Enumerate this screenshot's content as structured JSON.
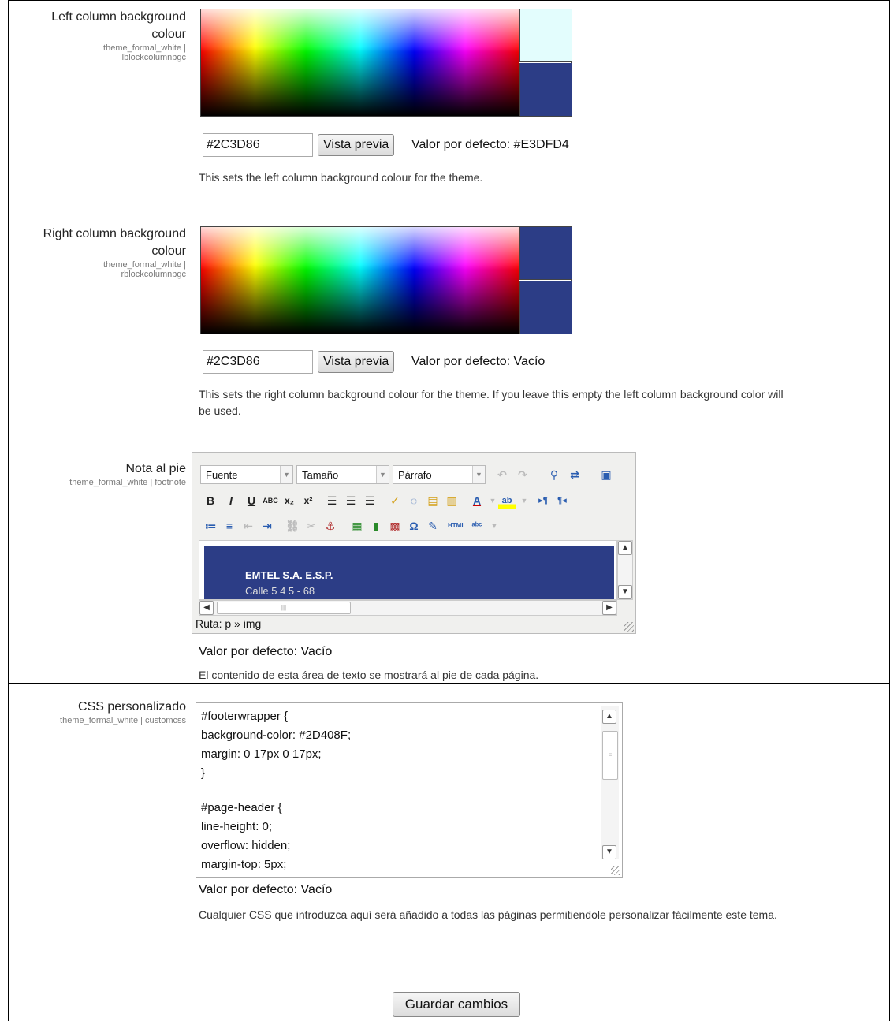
{
  "left_colour": {
    "title_line1": "Left column background",
    "title_line2": "colour",
    "sub_line1": "theme_formal_white |",
    "sub_line2": "lblockcolumnbgc",
    "swatch_top_color": "#E3FDFD",
    "swatch_bottom_color": "#2C3D86",
    "value": "#2C3D86",
    "preview_label": "Vista previa",
    "default_text": "Valor por defecto: #E3DFD4",
    "description": "This sets the left column background colour for the theme."
  },
  "right_colour": {
    "title_line1": "Right column background",
    "title_line2": "colour",
    "sub_line1": "theme_formal_white |",
    "sub_line2": "rblockcolumnbgc",
    "swatch_top_color": "#2C3D86",
    "swatch_bottom_color": "#2C3D86",
    "value": "#2C3D86",
    "preview_label": "Vista previa",
    "default_text": "Valor por defecto: Vacío",
    "description_line1": "This sets the right column background colour for the theme. If you leave this empty the left column background color will",
    "description_line2": "be used."
  },
  "footnote": {
    "title": "Nota al pie",
    "sub": "theme_formal_white | footnote",
    "font_select": "Fuente",
    "size_select": "Tamaño",
    "format_select": "Párrafo",
    "content_line1": "EMTEL S.A. E.S.P.",
    "content_line2": "Calle 5 4 5 - 68",
    "path": "Ruta: p » img",
    "default_text": "Valor por defecto: Vacío",
    "description": "El contenido de esta área de texto se mostrará al pie de cada página."
  },
  "custom_css": {
    "title": "CSS personalizado",
    "sub": "theme_formal_white | customcss",
    "lines": [
      "#footerwrapper {",
      "background-color: #2D408F;",
      "margin: 0 17px 0 17px;",
      "}",
      "",
      "#page-header {",
      "line-height: 0;",
      "overflow: hidden;",
      "margin-top: 5px;"
    ],
    "default_text": "Valor por defecto: Vacío",
    "description": "Cualquier CSS que introduzca aquí será añadido a todas las páginas permitiendole personalizar fácilmente este tema."
  },
  "save_label": "Guardar cambios"
}
